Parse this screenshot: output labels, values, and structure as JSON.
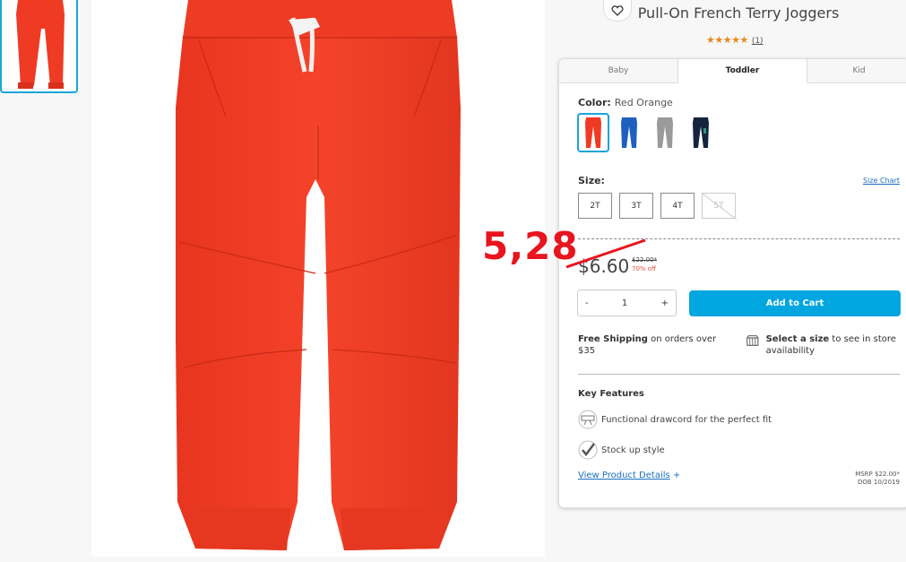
{
  "product": {
    "title": "Pull-On French Terry Joggers",
    "rating_stars": "★★★★★",
    "rating_count": "(1)"
  },
  "tabs": [
    "Baby",
    "Toddler",
    "Kid"
  ],
  "color": {
    "label": "Color:",
    "value": "Red Orange",
    "swatches": [
      "red-orange",
      "blue",
      "gray",
      "navy"
    ]
  },
  "size": {
    "label": "Size:",
    "chart_link": "Size Chart",
    "options": [
      "2T",
      "3T",
      "4T",
      "5T"
    ]
  },
  "price": {
    "sale": "$6.60",
    "original": "$22.00*",
    "discount": "70% off"
  },
  "quantity": {
    "minus": "-",
    "value": "1",
    "plus": "+"
  },
  "cart_button": "Add to Cart",
  "shipping": {
    "bold": "Free Shipping",
    "text": " on orders over $35"
  },
  "store": {
    "bold": "Select a size",
    "text": " to see in store availability"
  },
  "key_features": {
    "title": "Key Features",
    "items": [
      "Functional drawcord for the perfect fit",
      "Stock up style"
    ]
  },
  "details_link": "View Product Details",
  "details_plus": "+",
  "msrp": {
    "line1": "MSRP $22.00*",
    "line2": "DOB 10/2019"
  },
  "annotation": "5,28",
  "colors": {
    "accent": "#00a6e0",
    "pants": "#ef3b24",
    "star": "#e8871e",
    "annotation": "#e8141e"
  }
}
